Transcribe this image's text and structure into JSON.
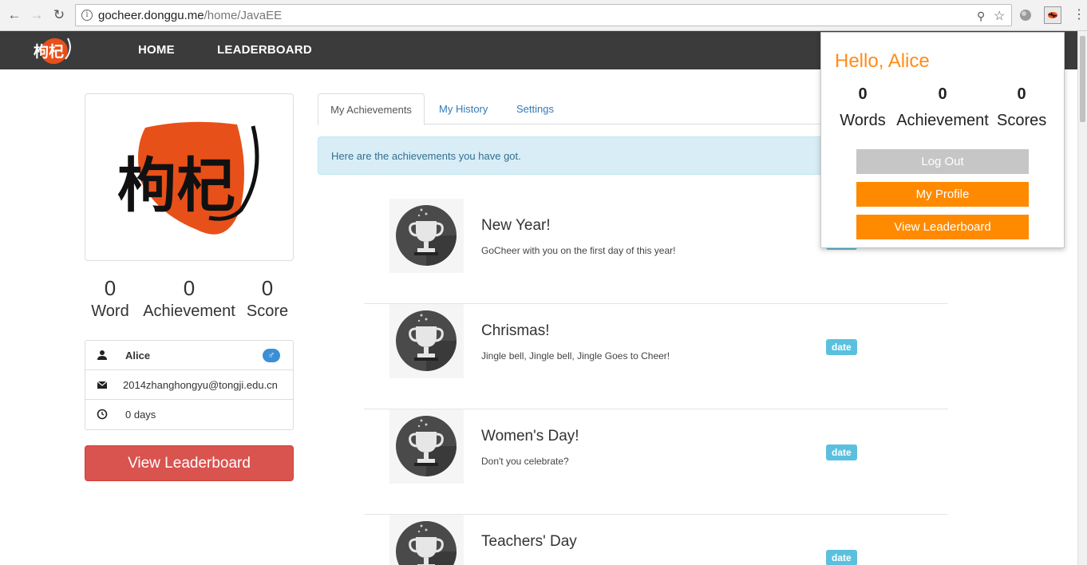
{
  "browser": {
    "url_host": "gocheer.donggu.me",
    "url_path": "/home/JavaEE"
  },
  "navbar": {
    "logo_text": "枸杞",
    "links": [
      "HOME",
      "LEADERBOARD"
    ]
  },
  "profile": {
    "logo_text": "枸杞",
    "stats": [
      {
        "value": "0",
        "label": "Word"
      },
      {
        "value": "0",
        "label": "Achievement"
      },
      {
        "value": "0",
        "label": "Score"
      }
    ],
    "name": "Alice",
    "gender_symbol": "♂",
    "email": "2014zhanghongyu@tongji.edu.cn",
    "days": "0 days",
    "leaderboard_button": "View Leaderboard"
  },
  "tabs": [
    "My Achievements",
    "My History",
    "Settings"
  ],
  "alert_text": "Here are the achievements you have got.",
  "achievements": [
    {
      "title": "New Year!",
      "desc": "GoCheer with you on the first day of this year!",
      "badge": "date"
    },
    {
      "title": "Chrismas!",
      "desc": "Jingle bell, Jingle bell, Jingle Goes to Cheer!",
      "badge": "date"
    },
    {
      "title": "Women's Day!",
      "desc": "Don't you celebrate?",
      "badge": "date"
    },
    {
      "title": "Teachers' Day",
      "desc": "",
      "badge": "date"
    }
  ],
  "popup": {
    "greeting": "Hello, Alice",
    "stats": [
      {
        "value": "0",
        "label": "Words"
      },
      {
        "value": "0",
        "label": "Achievement"
      },
      {
        "value": "0",
        "label": "Scores"
      }
    ],
    "buttons": [
      "Log Out",
      "My Profile",
      "View Leaderboard"
    ]
  },
  "colors": {
    "accent_orange": "#ff8a00",
    "danger_red": "#d9534f",
    "info_blue": "#5bc0de",
    "navbar_dark": "#3b3b3b"
  }
}
